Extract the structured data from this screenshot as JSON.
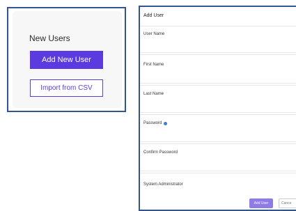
{
  "users_card": {
    "title": "New Users",
    "add_button_label": "Add New User",
    "import_button_label": "Import from CSV"
  },
  "add_user_form": {
    "title": "Add User",
    "fields": [
      {
        "label": "User Name",
        "value": ""
      },
      {
        "label": "First Name",
        "value": ""
      },
      {
        "label": "Last Name",
        "value": ""
      },
      {
        "label": "Password",
        "value": ""
      },
      {
        "label": "Confirm Password",
        "value": ""
      }
    ],
    "admin_label": "System Administrator",
    "admin_checked": false,
    "submit_label": "Add User",
    "cancel_label": "Cance"
  },
  "colors": {
    "primary": "#5b3be0",
    "primary_light": "#8f7be8",
    "frame": "#2f5597",
    "info": "#3d7dd8"
  }
}
